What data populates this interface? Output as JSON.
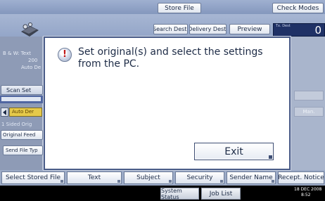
{
  "header": {
    "store_file_label": "Store File",
    "check_modes_label": "Check Modes",
    "search_dest_label": "Search Dest.",
    "delivery_dest_label": "Delivery Dest.",
    "preview_label": "Preview",
    "counter_label": "Tx. Dest",
    "counter_value": "0"
  },
  "left_panel": {
    "mode_text": "B & W: Text",
    "res_text": "200",
    "auto_text": "Auto De",
    "scan_settings_label": "Scan Set",
    "auto_density_label": "Auto Der",
    "sided_label": "1 Sided Orig",
    "original_feed_label": "Original Feed",
    "send_file_type_label": "Send File Typ"
  },
  "right_panel": {
    "ghost1": "",
    "ghost2": "Man."
  },
  "dialog": {
    "message": "Set original(s) and select the settings from the PC.",
    "exit_label": "Exit"
  },
  "tabs": [
    {
      "label": "Select Stored File"
    },
    {
      "label": "Text"
    },
    {
      "label": "Subject"
    },
    {
      "label": "Security"
    },
    {
      "label": "Sender Name"
    },
    {
      "label": "Recept. Notice"
    }
  ],
  "status": {
    "system_status_label": "System Status",
    "job_list_label": "Job List",
    "date": "18 DEC  2008",
    "time": "8:52"
  }
}
